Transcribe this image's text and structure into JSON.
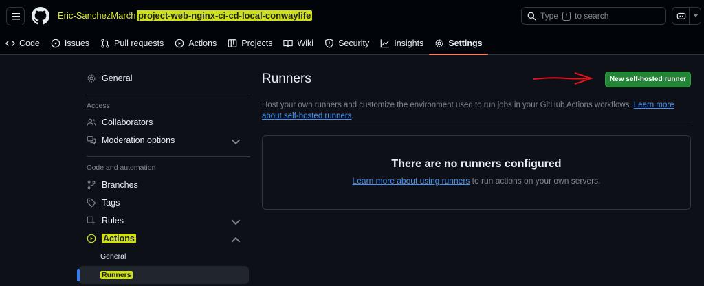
{
  "header": {
    "owner": "Eric-SanchezMarch",
    "separator": "/",
    "repo": "project-web-nginx-ci-cd-local-conwaylife",
    "search_placeholder": "Type",
    "search_key": "/",
    "search_suffix": "to search"
  },
  "tabs": [
    {
      "label": "Code",
      "icon": "code-icon"
    },
    {
      "label": "Issues",
      "icon": "issue-icon"
    },
    {
      "label": "Pull requests",
      "icon": "pull-request-icon"
    },
    {
      "label": "Actions",
      "icon": "play-icon"
    },
    {
      "label": "Projects",
      "icon": "table-icon"
    },
    {
      "label": "Wiki",
      "icon": "book-icon"
    },
    {
      "label": "Security",
      "icon": "shield-icon"
    },
    {
      "label": "Insights",
      "icon": "graph-icon"
    },
    {
      "label": "Settings",
      "icon": "gear-icon",
      "active": true
    }
  ],
  "sidebar": {
    "general": "General",
    "access_heading": "Access",
    "collaborators": "Collaborators",
    "moderation": "Moderation options",
    "code_heading": "Code and automation",
    "branches": "Branches",
    "tags": "Tags",
    "rules": "Rules",
    "actions": "Actions",
    "actions_general": "General",
    "actions_runners": "Runners"
  },
  "main": {
    "title": "Runners",
    "new_button": "New self-hosted runner",
    "description": "Host your own runners and customize the environment used to run jobs in your GitHub Actions workflows.",
    "learn_more_1": "Learn more",
    "learn_more_2": "about self-hosted runners",
    "desc_end": ".",
    "empty_title": "There are no runners configured",
    "empty_link": "Learn more about using runners",
    "empty_text": "to run actions on your own servers."
  },
  "colors": {
    "background": "#0d1117",
    "header": "#010409",
    "accent_green": "#238636",
    "link": "#4493f8",
    "highlight": "#cfe01a",
    "arrow": "#e3121b"
  }
}
